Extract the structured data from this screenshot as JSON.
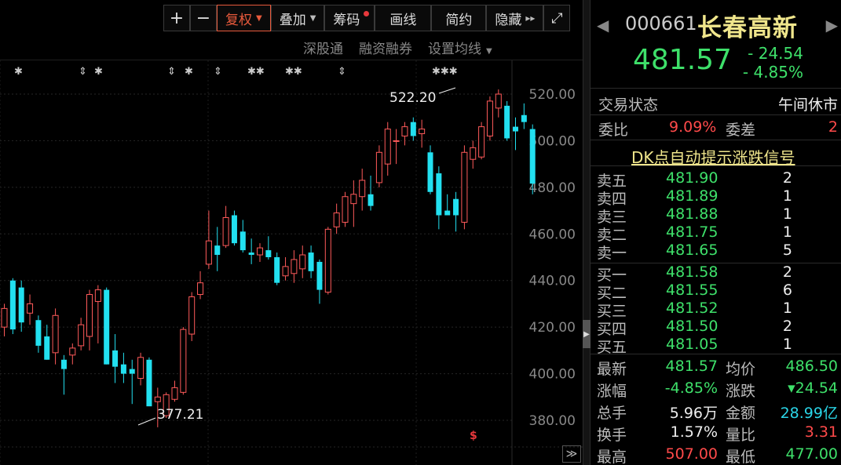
{
  "toolbar": {
    "plus": "+",
    "minus": "−",
    "fuquan": "复权",
    "diejia": "叠加",
    "chouma": "筹码",
    "huaxian": "画线",
    "jianyue": "简约",
    "yincang": "隐藏",
    "fullscreen": "⤢"
  },
  "subtools": {
    "shengutong": "深股通",
    "rongzi": "融资融券",
    "junxian": "设置均线"
  },
  "annotations": {
    "high": "522.20",
    "low": "377.21",
    "marker": "$"
  },
  "chart_data": {
    "type": "candlestick",
    "yticks": [
      "520.00",
      "500.00",
      "480.00",
      "460.00",
      "440.00",
      "420.00",
      "400.00",
      "380.00"
    ],
    "ylim": [
      372,
      528
    ],
    "up_color": "#ff5a5a",
    "down_color": "#22e0f0",
    "candles": [
      {
        "o": 420,
        "h": 430,
        "l": 416,
        "c": 428
      },
      {
        "o": 440,
        "h": 441,
        "l": 417,
        "c": 419
      },
      {
        "o": 437,
        "h": 440,
        "l": 418,
        "c": 422
      },
      {
        "o": 426,
        "h": 434,
        "l": 421,
        "c": 430
      },
      {
        "o": 423,
        "h": 425,
        "l": 409,
        "c": 412
      },
      {
        "o": 416,
        "h": 421,
        "l": 406,
        "c": 406
      },
      {
        "o": 409,
        "h": 428,
        "l": 404,
        "c": 425
      },
      {
        "o": 406,
        "h": 408,
        "l": 391,
        "c": 402
      },
      {
        "o": 408,
        "h": 413,
        "l": 404,
        "c": 411
      },
      {
        "o": 412,
        "h": 424,
        "l": 410,
        "c": 421
      },
      {
        "o": 416,
        "h": 436,
        "l": 410,
        "c": 434
      },
      {
        "o": 431,
        "h": 438,
        "l": 413,
        "c": 436
      },
      {
        "o": 436,
        "h": 437,
        "l": 404,
        "c": 404
      },
      {
        "o": 410,
        "h": 417,
        "l": 396,
        "c": 403
      },
      {
        "o": 404,
        "h": 409,
        "l": 396,
        "c": 400
      },
      {
        "o": 402,
        "h": 406,
        "l": 387,
        "c": 400
      },
      {
        "o": 398,
        "h": 409,
        "l": 395,
        "c": 407
      },
      {
        "o": 406,
        "h": 407,
        "l": 387,
        "c": 386
      },
      {
        "o": 388,
        "h": 394,
        "l": 377,
        "c": 390
      },
      {
        "o": 382,
        "h": 392,
        "l": 381,
        "c": 391
      },
      {
        "o": 389,
        "h": 397,
        "l": 388,
        "c": 394
      },
      {
        "o": 392,
        "h": 420,
        "l": 391,
        "c": 419
      },
      {
        "o": 417,
        "h": 435,
        "l": 414,
        "c": 433
      },
      {
        "o": 434,
        "h": 444,
        "l": 432,
        "c": 439
      },
      {
        "o": 447,
        "h": 470,
        "l": 445,
        "c": 457
      },
      {
        "o": 455,
        "h": 463,
        "l": 444,
        "c": 451
      },
      {
        "o": 455,
        "h": 472,
        "l": 454,
        "c": 467
      },
      {
        "o": 468,
        "h": 470,
        "l": 455,
        "c": 456
      },
      {
        "o": 461,
        "h": 466,
        "l": 452,
        "c": 453
      },
      {
        "o": 452,
        "h": 458,
        "l": 447,
        "c": 451
      },
      {
        "o": 451,
        "h": 456,
        "l": 448,
        "c": 454
      },
      {
        "o": 453,
        "h": 459,
        "l": 449,
        "c": 450
      },
      {
        "o": 450,
        "h": 452,
        "l": 438,
        "c": 439
      },
      {
        "o": 442,
        "h": 450,
        "l": 440,
        "c": 446
      },
      {
        "o": 443,
        "h": 453,
        "l": 439,
        "c": 449
      },
      {
        "o": 445,
        "h": 455,
        "l": 441,
        "c": 451
      },
      {
        "o": 452,
        "h": 455,
        "l": 441,
        "c": 444
      },
      {
        "o": 448,
        "h": 449,
        "l": 430,
        "c": 436
      },
      {
        "o": 435,
        "h": 463,
        "l": 434,
        "c": 462
      },
      {
        "o": 463,
        "h": 473,
        "l": 460,
        "c": 469
      },
      {
        "o": 465,
        "h": 478,
        "l": 463,
        "c": 476
      },
      {
        "o": 473,
        "h": 483,
        "l": 463,
        "c": 477
      },
      {
        "o": 476,
        "h": 488,
        "l": 470,
        "c": 483
      },
      {
        "o": 477,
        "h": 485,
        "l": 470,
        "c": 472
      },
      {
        "o": 482,
        "h": 498,
        "l": 480,
        "c": 495
      },
      {
        "o": 490,
        "h": 508,
        "l": 485,
        "c": 505
      },
      {
        "o": 500,
        "h": 505,
        "l": 490,
        "c": 500
      },
      {
        "o": 502,
        "h": 508,
        "l": 498,
        "c": 506
      },
      {
        "o": 508,
        "h": 510,
        "l": 500,
        "c": 502
      },
      {
        "o": 503,
        "h": 509,
        "l": 497,
        "c": 505
      },
      {
        "o": 495,
        "h": 498,
        "l": 477,
        "c": 478
      },
      {
        "o": 486,
        "h": 489,
        "l": 462,
        "c": 468
      },
      {
        "o": 470,
        "h": 477,
        "l": 468,
        "c": 468
      },
      {
        "o": 475,
        "h": 478,
        "l": 461,
        "c": 468
      },
      {
        "o": 465,
        "h": 498,
        "l": 462,
        "c": 495
      },
      {
        "o": 492,
        "h": 500,
        "l": 488,
        "c": 497
      },
      {
        "o": 493,
        "h": 508,
        "l": 492,
        "c": 506
      },
      {
        "o": 502,
        "h": 519,
        "l": 500,
        "c": 517
      },
      {
        "o": 514,
        "h": 522,
        "l": 510,
        "c": 520
      },
      {
        "o": 515,
        "h": 517,
        "l": 500,
        "c": 501
      },
      {
        "o": 506,
        "h": 510,
        "l": 496,
        "c": 504
      },
      {
        "o": 511,
        "h": 516,
        "l": 505,
        "c": 508
      },
      {
        "o": 505,
        "h": 507,
        "l": 477,
        "c": 481.57
      }
    ]
  },
  "quote": {
    "code": "000661",
    "name": "长春高新",
    "last": "481.57",
    "change": "- 24.54",
    "change_pct": "- 4.85%",
    "status_label": "交易状态",
    "status_value": "午间休市",
    "weibi_label": "委比",
    "weibi_value": "9.09%",
    "weicha_label": "委差",
    "weicha_value": "2",
    "signal": "DK点自动提示涨跌信号",
    "asks": [
      {
        "label": "卖五",
        "price": "481.90",
        "vol": "2"
      },
      {
        "label": "卖四",
        "price": "481.89",
        "vol": "1"
      },
      {
        "label": "卖三",
        "price": "481.88",
        "vol": "1"
      },
      {
        "label": "卖二",
        "price": "481.75",
        "vol": "1"
      },
      {
        "label": "卖一",
        "price": "481.65",
        "vol": "5"
      }
    ],
    "bids": [
      {
        "label": "买一",
        "price": "481.58",
        "vol": "2"
      },
      {
        "label": "买二",
        "price": "481.55",
        "vol": "6"
      },
      {
        "label": "买三",
        "price": "481.52",
        "vol": "1"
      },
      {
        "label": "买四",
        "price": "481.50",
        "vol": "2"
      },
      {
        "label": "买五",
        "price": "481.05",
        "vol": "1"
      }
    ],
    "stats": [
      {
        "l1": "最新",
        "v1": "481.57",
        "c1": "green",
        "l2": "均价",
        "v2": "486.50",
        "c2": "green"
      },
      {
        "l1": "涨幅",
        "v1": "-4.85%",
        "c1": "green",
        "l2": "涨跌",
        "v2": "▾24.54",
        "c2": "green"
      },
      {
        "l1": "总手",
        "v1": "5.96万",
        "c1": "white",
        "l2": "金额",
        "v2": "28.99亿",
        "c2": "cyan"
      },
      {
        "l1": "换手",
        "v1": "1.57%",
        "c1": "white",
        "l2": "量比",
        "v2": "3.31",
        "c2": "red"
      },
      {
        "l1": "最高",
        "v1": "507.00",
        "c1": "red",
        "l2": "最低",
        "v2": "477.00",
        "c2": "green"
      }
    ]
  }
}
